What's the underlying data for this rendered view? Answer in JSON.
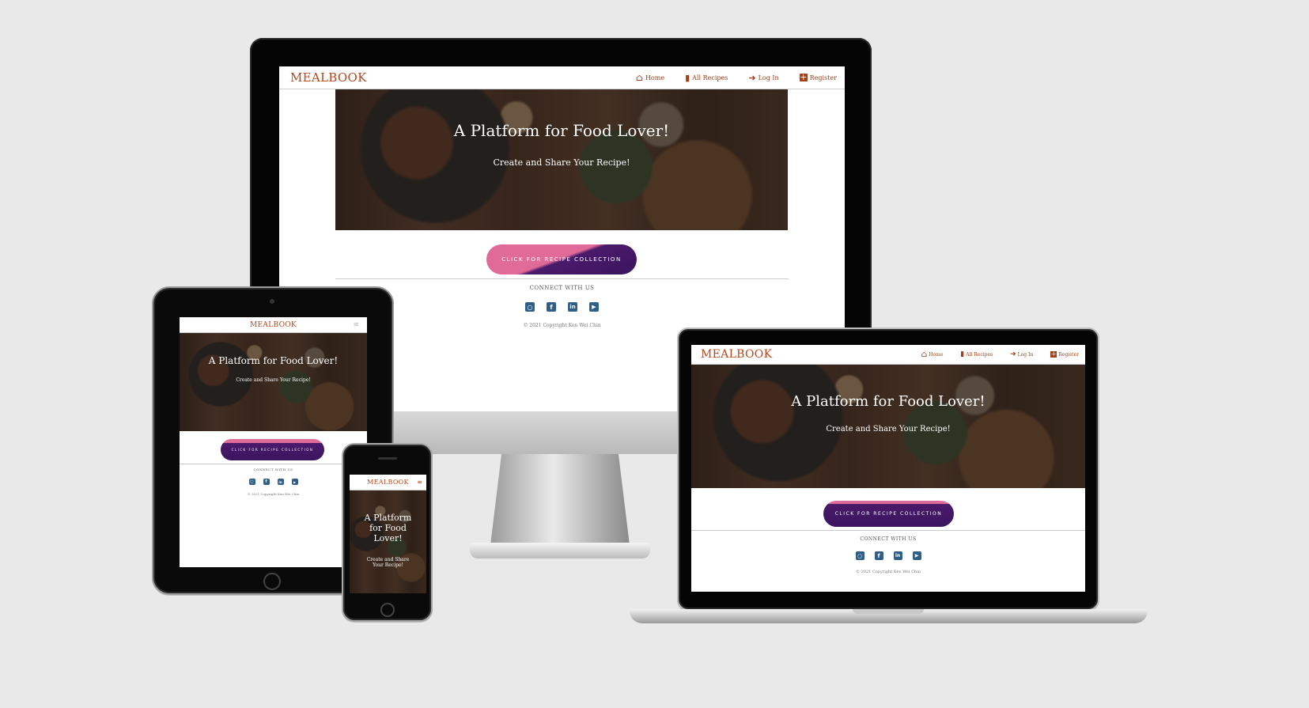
{
  "brand": "MEALBOOK",
  "nav": {
    "home": "Home",
    "all_recipes": "All Recipes",
    "login": "Log In",
    "register": "Register"
  },
  "hero": {
    "title": "A Platform for Food Lover!",
    "subtitle": "Create and Share Your Recipe!"
  },
  "cta_label": "CLICK FOR RECIPE COLLECTION",
  "connect_label": "CONNECT WITH US",
  "copyright": "© 2021 Copyright Ken Wei Chin",
  "social": [
    "github-icon",
    "facebook-icon",
    "linkedin-icon",
    "youtube-icon"
  ],
  "icons": {
    "home": "⌂",
    "book": "▮",
    "login": "➜",
    "register": "+",
    "menu": "≡"
  },
  "colors": {
    "brand": "#b5471b",
    "cta_pink": "#e06a98",
    "cta_purple": "#3b145e",
    "social": "#2f5f86",
    "background": "#e9e9ea"
  }
}
